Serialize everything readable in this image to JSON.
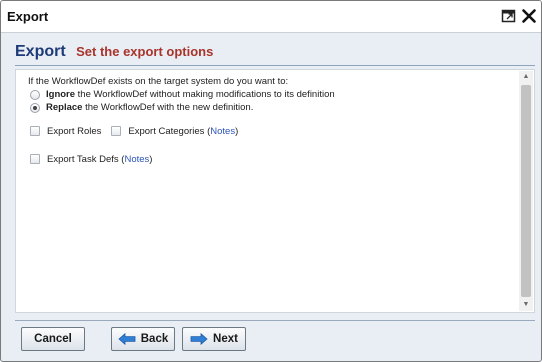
{
  "window": {
    "title": "Export",
    "icons": [
      "popout-icon",
      "close-icon"
    ]
  },
  "header": {
    "title": "Export",
    "subtitle": "Set the export options"
  },
  "options": {
    "prompt": "If the WorkflowDef exists on the target system do you want to:",
    "ignore": {
      "bold": "Ignore",
      "text": " the WorkflowDef without making modifications to its definition",
      "checked": false
    },
    "replace": {
      "bold": "Replace",
      "text": " the WorkflowDef with the new definition.",
      "checked": true
    },
    "export_roles": "Export Roles",
    "export_categories": "Export Categories",
    "export_task_defs": "Export Task Defs",
    "notes_link": "Notes",
    "paren_open": "(",
    "paren_close": ")"
  },
  "buttons": {
    "cancel": "Cancel",
    "back": "Back",
    "next": "Next"
  },
  "colors": {
    "header_title": "#1f3a78",
    "header_subtitle": "#a8342b",
    "link": "#2d54b8",
    "arrow_icon": "#2f7fd6"
  }
}
